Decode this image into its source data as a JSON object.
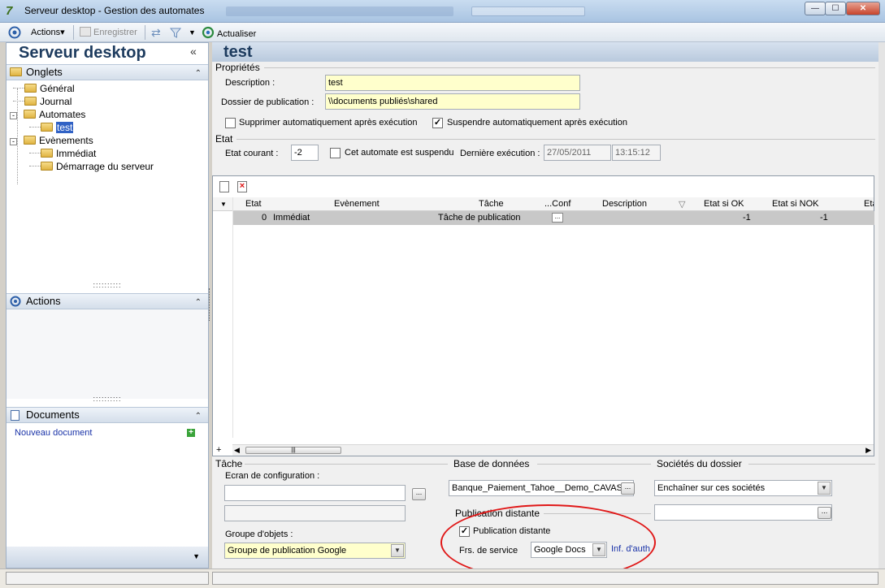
{
  "window": {
    "title": "Serveur desktop -  Gestion des automates",
    "app_icon": "app-logo-icon",
    "controls": [
      "minimize",
      "maximize",
      "close"
    ]
  },
  "toolbar": {
    "actions_label": "Actions",
    "save_label": "Enregistrer",
    "refresh_label": "Actualiser"
  },
  "left": {
    "header": "Serveur desktop",
    "onglets_title": "Onglets",
    "tree": [
      {
        "label": "Général"
      },
      {
        "label": "Journal"
      },
      {
        "label": "Automates"
      },
      {
        "label": "test"
      },
      {
        "label": "Evènements"
      },
      {
        "label": "Immédiat"
      },
      {
        "label": "Démarrage du serveur"
      }
    ],
    "actions_title": "Actions",
    "documents_title": "Documents",
    "new_document": "Nouveau document"
  },
  "right": {
    "header": "test",
    "props_group": "Propriétés",
    "description_label": "Description :",
    "description_value": "test",
    "folder_label": "Dossier de publication :",
    "folder_value": "\\\\documents publiés\\shared",
    "auto_delete_label": "Supprimer automatiquement après exécution",
    "auto_delete_checked": false,
    "auto_suspend_label": "Suspendre automatiquement après exécution",
    "auto_suspend_checked": true,
    "state_group": "Etat",
    "current_state_label": "Etat courant :",
    "current_state_value": "-2",
    "suspended_label": "Cet automate est suspendu",
    "suspended_checked": false,
    "last_exec_label": "Dernière exécution :",
    "last_exec_date": "27/05/2011",
    "last_exec_time": "13:15:12"
  },
  "grid": {
    "columns": [
      "Etat",
      "Evènement",
      "Tâche",
      "...Conf",
      "Description",
      "Etat si OK",
      "Etat si NOK",
      "Eta"
    ],
    "rows": [
      {
        "etat": "0",
        "evenement": "Immédiat",
        "tache": "Tâche de publication",
        "conf": "...",
        "description": "",
        "ok": "-1",
        "nok": "-1"
      }
    ]
  },
  "bottom": {
    "task_group": "Tâche",
    "config_label": "Ecran de configuration :",
    "config_value": "",
    "objects_group_label": "Groupe d'objets :",
    "objects_group_value": "Groupe de publication Google",
    "db_group": "Base de données",
    "db_value": "Banque_Paiement_Tahoe__Demo_CAVAS",
    "societies_group": "Sociétés du dossier",
    "societies_value": "Enchaîner sur ces sociétés",
    "remote_group": "Publication distante",
    "remote_label": "Publication distante",
    "remote_checked": true,
    "provider_label": "Frs. de service",
    "provider_value": "Google Docs",
    "auth_link": "Inf. d'auth"
  },
  "colors": {
    "annotation_ellipse": "#e01818",
    "field_yellow": "#ffffcc",
    "header_blue": "#1d3b5e",
    "link": "#1a33a8"
  }
}
